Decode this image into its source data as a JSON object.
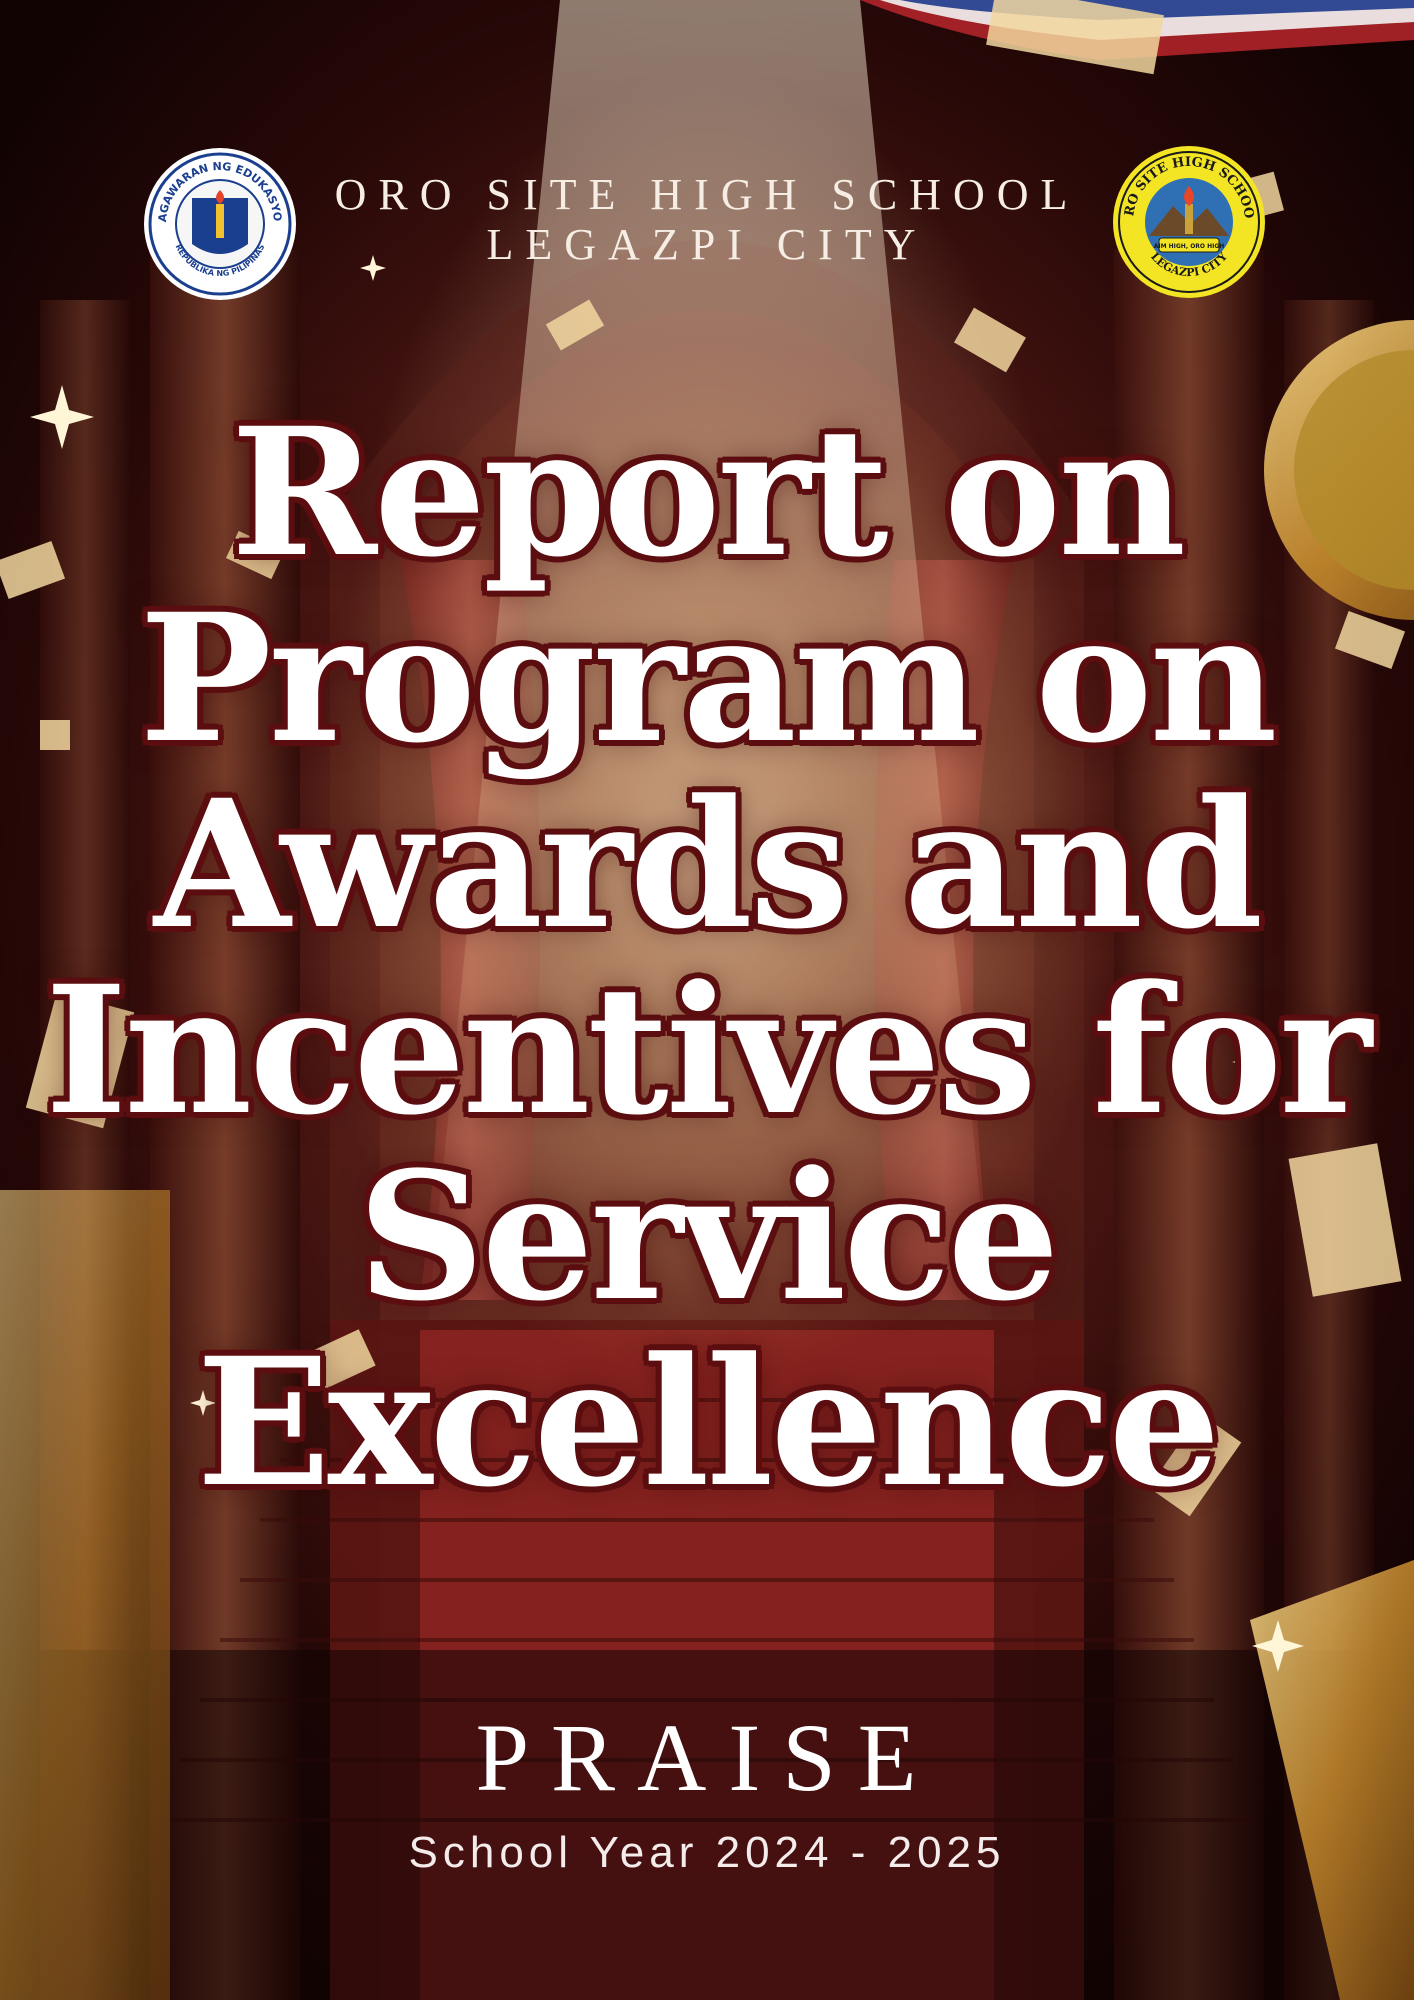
{
  "header": {
    "school_name": "ORO SITE HIGH SCHOOL",
    "city": "LEGAZPI CITY"
  },
  "seals": {
    "left": {
      "top_text": "KAGAWARAN NG EDUKASYON",
      "bottom_text": "REPUBLIKA NG PILIPINAS"
    },
    "right": {
      "top_text": "ORO SITE HIGH SCHOOL",
      "bottom_text": "LEGAZPI CITY",
      "ribbon_text": "AIM HIGH, ORO HIGH"
    }
  },
  "title_lines": [
    "Report on",
    "Program on",
    "Awards and",
    "Incentives for",
    "Service",
    "Excellence"
  ],
  "acronym": "PRAISE",
  "school_year": "School Year 2024 - 2025",
  "colors": {
    "title_fill": "#ffffff",
    "title_outline": "#5b0d0f",
    "gold": "#d9a441",
    "deep_red": "#4a1612"
  }
}
